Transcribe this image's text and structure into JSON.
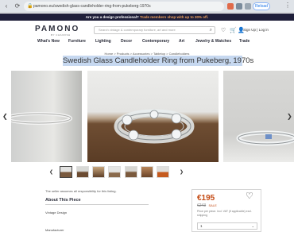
{
  "browser": {
    "url": "pamono.eu/swedish-glass-candleholder-ring-from-pukeberg-1970s",
    "reload_label": "Reload"
  },
  "promo": {
    "text_a": "Are you a design professional?",
    "text_b": "Trade members shop with up to 30% off."
  },
  "header": {
    "logo": "PAMONO",
    "logo_sub": "BY CHAIRISH",
    "search_placeholder": "Search vintage & contemporary furniture, art and more",
    "signin": "Sign Up | Log in"
  },
  "nav": [
    "What's New",
    "Furniture",
    "Lighting",
    "Decor",
    "Contemporary",
    "Art",
    "Jewelry & Watches",
    "Trade"
  ],
  "breadcrumb": "Home > Products > Accessories > Tabletop > Candleholders",
  "product": {
    "title": "Swedish Glass Candleholder Ring from Pukeberg, 1970s",
    "price": "€195",
    "old_price": "€243",
    "sale": "SALE",
    "price_note": "Price per piece. Incl. VAT (if applicable) excl. shipping",
    "qty": "1"
  },
  "info": {
    "responsibility": "The seller assumes all responsibility for this listing.",
    "about": "About This Piece",
    "vintage": "Vintage Design",
    "manufacturer": "Manufacturer"
  },
  "colors": {
    "brand_dark": "#2b2d3a",
    "accent_orange": "#c44a13",
    "title_highlight": "#c6d8f0"
  }
}
